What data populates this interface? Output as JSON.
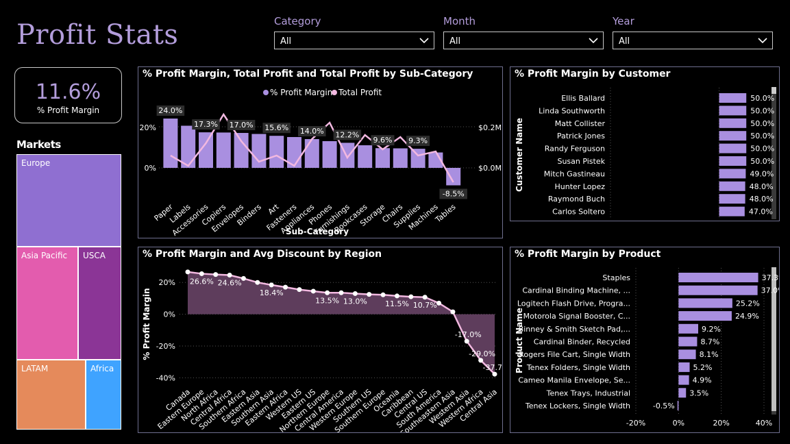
{
  "header": {
    "title": "Profit Stats"
  },
  "slicers": [
    {
      "label": "Category",
      "value": "All"
    },
    {
      "label": "Month",
      "value": "All"
    },
    {
      "label": "Year",
      "value": "All"
    }
  ],
  "kpi": {
    "value": "11.6%",
    "caption": "% Profit Margin"
  },
  "markets": {
    "title": "Markets",
    "items": [
      {
        "name": "Europe",
        "color": "#8f6fd1"
      },
      {
        "name": "Asia Pacific",
        "color": "#e35cae"
      },
      {
        "name": "USCA",
        "color": "#8b3596"
      },
      {
        "name": "LATAM",
        "color": "#e58a5b"
      },
      {
        "name": "Africa",
        "color": "#3fa3ff"
      }
    ]
  },
  "colors": {
    "bar": "#a98fe0",
    "line": "#f2b8e0",
    "area": "#5e3d5c",
    "axis": "#ffffff"
  },
  "chart_data": [
    {
      "type": "bar",
      "title": "% Profit Margin, Total Profit and Total Profit by Sub-Category",
      "legend": [
        "% Profit Margin",
        "Total Profit"
      ],
      "xlabel": "Sub-Category",
      "categories": [
        "Paper",
        "Labels",
        "Accessories",
        "Copiers",
        "Envelopes",
        "Binders",
        "Art",
        "Fasteners",
        "Appliances",
        "Phones",
        "Furnishings",
        "Bookcases",
        "Storage",
        "Chairs",
        "Supplies",
        "Machines",
        "Tables"
      ],
      "series": [
        {
          "name": "% Profit Margin",
          "values": [
            24.0,
            20.5,
            17.3,
            17.2,
            17.0,
            16.5,
            15.6,
            15.0,
            14.0,
            13.0,
            12.2,
            11.0,
            9.6,
            9.5,
            9.3,
            7.5,
            -8.5
          ]
        },
        {
          "name": "Total Profit",
          "values": [
            0.06,
            0.01,
            0.12,
            0.26,
            0.13,
            0.03,
            0.06,
            0.01,
            0.14,
            0.22,
            0.05,
            0.16,
            0.09,
            0.15,
            0.06,
            0.08,
            -0.07
          ]
        }
      ],
      "data_labels": [
        "24.0%",
        "",
        "17.3%",
        "",
        "17.0%",
        "",
        "15.6%",
        "",
        "14.0%",
        "",
        "12.2%",
        "",
        "9.6%",
        "",
        "9.3%",
        "",
        "-8.5%"
      ],
      "y_ticks_left": [
        "20%",
        "0%"
      ],
      "y_ticks_right": [
        "$0.2M",
        "$0.0M"
      ],
      "ylim_left": [
        -10,
        30
      ],
      "ylim_right": [
        -0.1,
        0.3
      ]
    },
    {
      "type": "bar",
      "orientation": "horizontal",
      "title": "% Profit Margin by Customer",
      "ylabel": "Customer Name",
      "categories": [
        "Ellis Ballard",
        "Linda Southworth",
        "Matt Collister",
        "Patrick Jones",
        "Randy Ferguson",
        "Susan Pistek",
        "Mitch Gastineau",
        "Hunter Lopez",
        "Raymond Buch",
        "Carlos Soltero"
      ],
      "values": [
        50.0,
        50.0,
        50.0,
        50.0,
        50.0,
        50.0,
        49.0,
        48.0,
        48.0,
        47.0
      ],
      "data_labels": [
        "50.0%",
        "50.0%",
        "50.0%",
        "50.0%",
        "50.0%",
        "50.0%",
        "49.0%",
        "48.0%",
        "48.0%",
        "47.0%"
      ],
      "x_ticks": [
        "-200%",
        "0%"
      ],
      "xlim": [
        -200,
        80
      ]
    },
    {
      "type": "area",
      "title": "% Profit Margin and Avg Discount by Region",
      "ylabel": "% Profit Margin",
      "categories": [
        "Canada",
        "Eastern Europe",
        "North Africa",
        "Central Africa",
        "Southern Africa",
        "Eastern Asia",
        "Southern Asia",
        "Eastern Africa",
        "Western US",
        "Eastern US",
        "Northern Europe",
        "Central America",
        "Western Europe",
        "Southern US",
        "Southern Europe",
        "Oceania",
        "Caribbean",
        "Central US",
        "South America",
        "Southeastern Asia",
        "Western Asia",
        "Western Africa",
        "Central Asia"
      ],
      "values": [
        26.6,
        25.5,
        25.0,
        24.6,
        22.5,
        20.0,
        18.4,
        17.0,
        15.5,
        14.5,
        13.5,
        13.5,
        13.0,
        12.5,
        12.2,
        11.5,
        11.0,
        10.7,
        7.0,
        1.5,
        -17.0,
        -29.0,
        -37.7
      ],
      "data_labels": [
        "",
        "26.6%",
        "",
        "24.6%",
        "",
        "",
        "18.4%",
        "",
        "",
        "",
        "13.5%",
        "",
        "13.0%",
        "",
        "",
        "11.5%",
        "",
        "10.7%",
        "",
        "",
        "-17.0%",
        "-29.0%",
        "-37.7%"
      ],
      "y_ticks": [
        "20%",
        "0%",
        "-20%",
        "-40%"
      ],
      "ylim": [
        -45,
        30
      ]
    },
    {
      "type": "bar",
      "orientation": "horizontal",
      "title": "% Profit Margin by Product",
      "ylabel": "Product Name",
      "categories": [
        "Staples",
        "Cardinal Binding Machine, ...",
        "Logitech Flash Drive, Progra...",
        "Motorola Signal Booster, C...",
        "Binney & Smith Sketch Pad,...",
        "Cardinal Binder, Recycled",
        "Rogers File Cart, Single Width",
        "Tenex Folders, Single Width",
        "Cameo Manila Envelope, Se...",
        "Tenex Trays, Industrial",
        "Tenex Lockers, Single Width"
      ],
      "values": [
        37.3,
        37.0,
        25.2,
        24.9,
        9.2,
        8.7,
        8.1,
        5.2,
        4.9,
        3.5,
        -0.5
      ],
      "data_labels": [
        "37.3%",
        "37.0%",
        "25.2%",
        "24.9%",
        "9.2%",
        "8.7%",
        "8.1%",
        "5.2%",
        "4.9%",
        "3.5%",
        "-0.5%"
      ],
      "x_ticks": [
        "-20%",
        "0%",
        "20%",
        "40%"
      ],
      "xlim": [
        -20,
        40
      ]
    }
  ]
}
